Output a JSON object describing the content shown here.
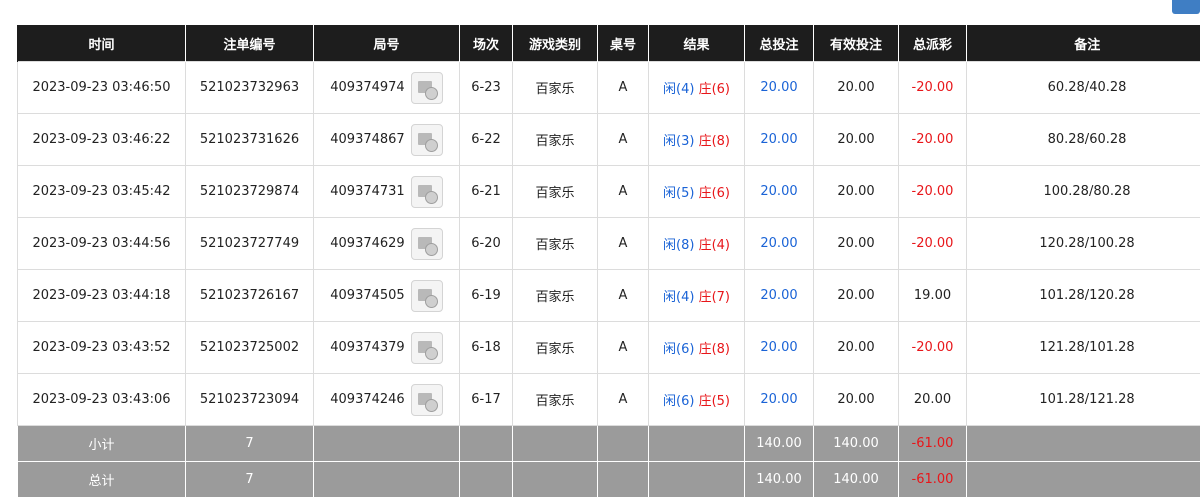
{
  "headers": [
    "时间",
    "注单编号",
    "局号",
    "场次",
    "游戏类别",
    "桌号",
    "结果",
    "总投注",
    "有效投注",
    "总派彩",
    "备注"
  ],
  "rows": [
    {
      "time": "2023-09-23 03:46:50",
      "bet_no": "521023732963",
      "round": "409374974",
      "scene": "6-23",
      "game": "百家乐",
      "table": "A",
      "player": "闲(4)",
      "banker": "庄(6)",
      "total_bet": "20.00",
      "valid_bet": "20.00",
      "payout": "-20.00",
      "payout_neg": true,
      "note": "60.28/40.28"
    },
    {
      "time": "2023-09-23 03:46:22",
      "bet_no": "521023731626",
      "round": "409374867",
      "scene": "6-22",
      "game": "百家乐",
      "table": "A",
      "player": "闲(3)",
      "banker": "庄(8)",
      "total_bet": "20.00",
      "valid_bet": "20.00",
      "payout": "-20.00",
      "payout_neg": true,
      "note": "80.28/60.28"
    },
    {
      "time": "2023-09-23 03:45:42",
      "bet_no": "521023729874",
      "round": "409374731",
      "scene": "6-21",
      "game": "百家乐",
      "table": "A",
      "player": "闲(5)",
      "banker": "庄(6)",
      "total_bet": "20.00",
      "valid_bet": "20.00",
      "payout": "-20.00",
      "payout_neg": true,
      "note": "100.28/80.28"
    },
    {
      "time": "2023-09-23 03:44:56",
      "bet_no": "521023727749",
      "round": "409374629",
      "scene": "6-20",
      "game": "百家乐",
      "table": "A",
      "player": "闲(8)",
      "banker": "庄(4)",
      "total_bet": "20.00",
      "valid_bet": "20.00",
      "payout": "-20.00",
      "payout_neg": true,
      "note": "120.28/100.28"
    },
    {
      "time": "2023-09-23 03:44:18",
      "bet_no": "521023726167",
      "round": "409374505",
      "scene": "6-19",
      "game": "百家乐",
      "table": "A",
      "player": "闲(4)",
      "banker": "庄(7)",
      "total_bet": "20.00",
      "valid_bet": "20.00",
      "payout": "19.00",
      "payout_neg": false,
      "note": "101.28/120.28"
    },
    {
      "time": "2023-09-23 03:43:52",
      "bet_no": "521023725002",
      "round": "409374379",
      "scene": "6-18",
      "game": "百家乐",
      "table": "A",
      "player": "闲(6)",
      "banker": "庄(8)",
      "total_bet": "20.00",
      "valid_bet": "20.00",
      "payout": "-20.00",
      "payout_neg": true,
      "note": "121.28/101.28"
    },
    {
      "time": "2023-09-23 03:43:06",
      "bet_no": "521023723094",
      "round": "409374246",
      "scene": "6-17",
      "game": "百家乐",
      "table": "A",
      "player": "闲(6)",
      "banker": "庄(5)",
      "total_bet": "20.00",
      "valid_bet": "20.00",
      "payout": "20.00",
      "payout_neg": false,
      "note": "101.28/121.28"
    }
  ],
  "subtotal": {
    "label": "小计",
    "count": "7",
    "total_bet": "140.00",
    "valid_bet": "140.00",
    "payout": "-61.00"
  },
  "total": {
    "label": "总计",
    "count": "7",
    "total_bet": "140.00",
    "valid_bet": "140.00",
    "payout": "-61.00"
  },
  "colors": {
    "header_bg": "#1d1d1d",
    "summary_bg": "#9b9b9b",
    "player": "#1a63d6",
    "negative": "#e8161a"
  }
}
